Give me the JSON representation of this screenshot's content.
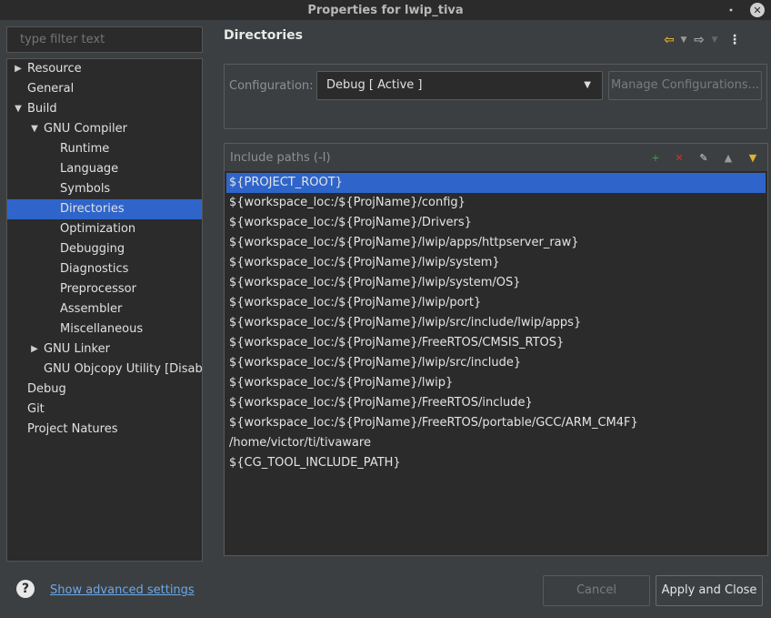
{
  "window": {
    "title": "Properties for lwip_tiva",
    "restore_glyph": "⬝",
    "close_glyph": "✕"
  },
  "sidebar": {
    "filter_placeholder": "type filter text",
    "items": [
      {
        "label": "Resource",
        "expander": "▶"
      },
      {
        "label": "General"
      },
      {
        "label": "Build",
        "expander": "▼"
      },
      {
        "label": "GNU Compiler",
        "expander": "▼"
      },
      {
        "label": "Runtime"
      },
      {
        "label": "Language"
      },
      {
        "label": "Symbols"
      },
      {
        "label": "Directories"
      },
      {
        "label": "Optimization"
      },
      {
        "label": "Debugging"
      },
      {
        "label": "Diagnostics"
      },
      {
        "label": "Preprocessor"
      },
      {
        "label": "Assembler"
      },
      {
        "label": "Miscellaneous"
      },
      {
        "label": "GNU Linker",
        "expander": "▶"
      },
      {
        "label": "GNU Objcopy Utility  [Disabled]"
      },
      {
        "label": "Debug"
      },
      {
        "label": "Git"
      },
      {
        "label": "Project Natures"
      }
    ]
  },
  "main": {
    "title": "Directories",
    "nav": {
      "back_glyph": "⇦",
      "back_menu_glyph": "▼",
      "forward_glyph": "⇨",
      "forward_menu_glyph": "▼",
      "more_glyph": "⋮"
    },
    "configuration": {
      "label": "Configuration:",
      "selected": "Debug  [ Active ]",
      "caret": "▼",
      "manage_label": "Manage Configurations..."
    },
    "include_paths": {
      "title": "Include paths (-I)",
      "tools": [
        {
          "name": "add-path-icon",
          "glyph": "+",
          "color": "#3aa34a"
        },
        {
          "name": "delete-path-icon",
          "glyph": "✕",
          "color": "#d03030"
        },
        {
          "name": "edit-path-icon",
          "glyph": "✎",
          "color": "#d8d8d8"
        },
        {
          "name": "move-up-icon",
          "glyph": "▲",
          "color": "#9a9a9a"
        },
        {
          "name": "move-down-icon",
          "glyph": "▼",
          "color": "#e0b030"
        }
      ],
      "paths": [
        "${PROJECT_ROOT}",
        "${workspace_loc:/${ProjName}/config}",
        "${workspace_loc:/${ProjName}/Drivers}",
        "${workspace_loc:/${ProjName}/lwip/apps/httpserver_raw}",
        "${workspace_loc:/${ProjName}/lwip/system}",
        "${workspace_loc:/${ProjName}/lwip/system/OS}",
        "${workspace_loc:/${ProjName}/lwip/port}",
        "${workspace_loc:/${ProjName}/lwip/src/include/lwip/apps}",
        "${workspace_loc:/${ProjName}/FreeRTOS/CMSIS_RTOS}",
        "${workspace_loc:/${ProjName}/lwip/src/include}",
        "${workspace_loc:/${ProjName}/lwip}",
        "${workspace_loc:/${ProjName}/FreeRTOS/include}",
        "${workspace_loc:/${ProjName}/FreeRTOS/portable/GCC/ARM_CM4F}",
        "/home/victor/ti/tivaware",
        "${CG_TOOL_INCLUDE_PATH}"
      ]
    }
  },
  "footer": {
    "help_glyph": "?",
    "advanced_link": "Show advanced settings",
    "cancel_label": "Cancel",
    "apply_label": "Apply and Close"
  }
}
